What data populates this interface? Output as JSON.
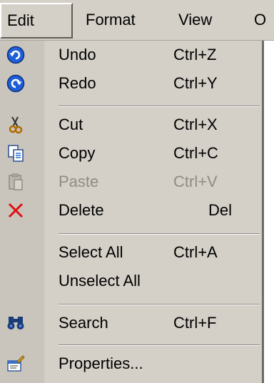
{
  "menubar": {
    "items": [
      "Edit",
      "Format",
      "View",
      "O"
    ]
  },
  "menu": {
    "undo": {
      "label": "Undo",
      "shortcut": "Ctrl+Z"
    },
    "redo": {
      "label": "Redo",
      "shortcut": "Ctrl+Y"
    },
    "cut": {
      "label": "Cut",
      "shortcut": "Ctrl+X"
    },
    "copy": {
      "label": "Copy",
      "shortcut": "Ctrl+C"
    },
    "paste": {
      "label": "Paste",
      "shortcut": "Ctrl+V",
      "disabled": true
    },
    "delete": {
      "label": "Delete",
      "shortcut": "Del"
    },
    "selectall": {
      "label": "Select All",
      "shortcut": "Ctrl+A"
    },
    "unselect": {
      "label": "Unselect All"
    },
    "search": {
      "label": "Search",
      "shortcut": "Ctrl+F"
    },
    "properties": {
      "label": "Properties..."
    }
  },
  "icons": {
    "undo": "undo-icon",
    "redo": "redo-icon",
    "cut": "scissors-icon",
    "copy": "copy-icon",
    "paste": "clipboard-icon",
    "delete": "delete-x-icon",
    "search": "binoculars-icon",
    "properties": "properties-icon"
  },
  "colors": {
    "menu_bg": "#d4d0c8",
    "icon_column_bg": "#c9c5bd",
    "disabled_text": "#8f8c86",
    "undo_redo_blue": "#1f5fd6",
    "delete_red": "#e01010"
  }
}
